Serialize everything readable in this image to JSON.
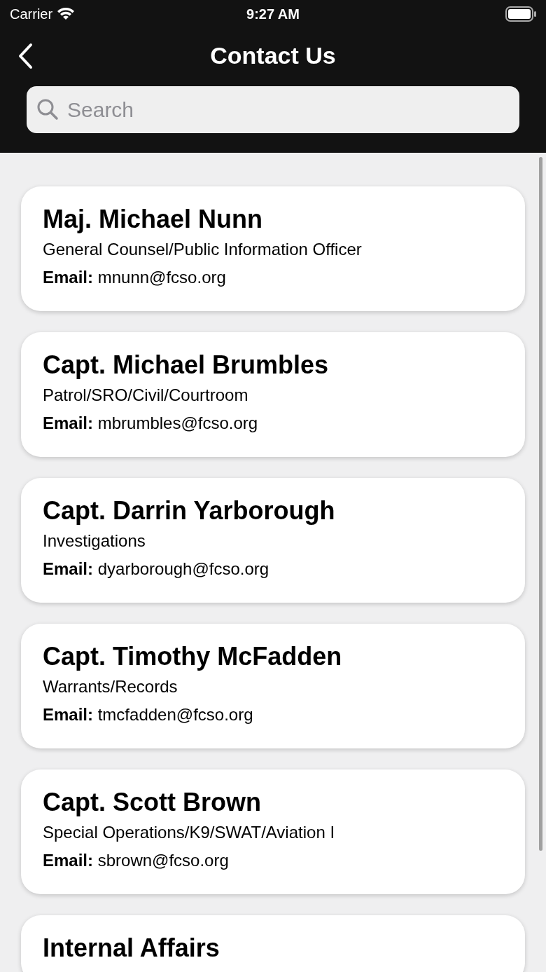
{
  "status_bar": {
    "carrier": "Carrier",
    "time": "9:27 AM"
  },
  "nav": {
    "title": "Contact Us"
  },
  "search": {
    "placeholder": "Search"
  },
  "contacts": [
    {
      "name": "Maj. Michael Nunn",
      "role": "General Counsel/Public Information Officer",
      "email_label": "Email:",
      "email": "mnunn@fcso.org"
    },
    {
      "name": "Capt. Michael Brumbles",
      "role": "Patrol/SRO/Civil/Courtroom",
      "email_label": "Email:",
      "email": "mbrumbles@fcso.org"
    },
    {
      "name": "Capt. Darrin Yarborough",
      "role": "Investigations",
      "email_label": "Email:",
      "email": "dyarborough@fcso.org"
    },
    {
      "name": "Capt. Timothy McFadden",
      "role": "Warrants/Records",
      "email_label": "Email:",
      "email": "tmcfadden@fcso.org"
    },
    {
      "name": "Capt. Scott Brown",
      "role": "Special Operations/K9/SWAT/Aviation I",
      "email_label": "Email:",
      "email": "sbrown@fcso.org"
    },
    {
      "name": "Internal Affairs"
    }
  ]
}
